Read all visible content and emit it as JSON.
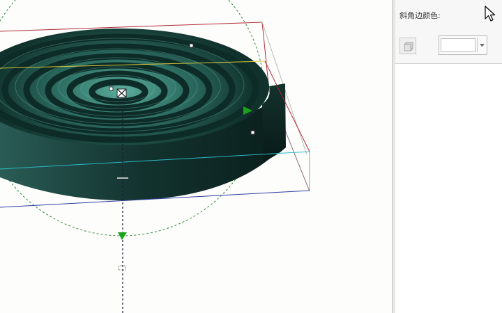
{
  "property_panel": {
    "bevel_color_label": "斜角边颜色:",
    "bevel_color_value": "#ffffff"
  },
  "icons": {
    "bevel_style": "bevel-style-icon",
    "dropdown": "chevron-down-icon",
    "cursor": "mouse-pointer-icon",
    "center_handle": "crosshair-icon",
    "rotation_arrow": "triangle-arrow-icon"
  },
  "colors": {
    "coil_dark": "#0c2b27",
    "coil_light": "#4fa091",
    "bbox_red": "#b2293a",
    "bbox_blue": "#2d3d9f",
    "guide_yellow": "#d8c83a",
    "guide_cyan": "#2bb8c7",
    "rotation_green": "#2f8a3c",
    "handle_green": "#1aa31a"
  }
}
